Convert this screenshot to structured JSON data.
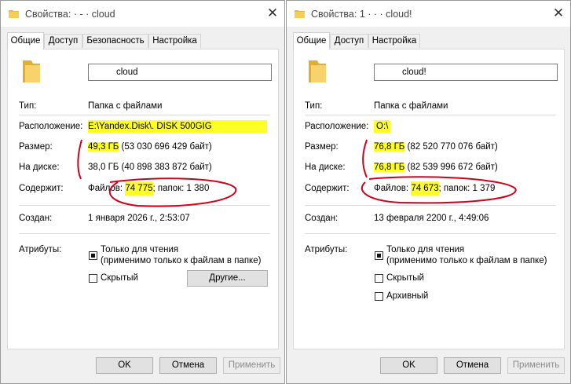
{
  "left": {
    "title": "Свойства: · - · cloud",
    "tabs": [
      "Общие",
      "Доступ",
      "Безопасность",
      "Настройка"
    ],
    "name_value": "cloud",
    "labels": {
      "type": "Тип:",
      "location": "Расположение:",
      "size": "Размер:",
      "on_disk": "На диске:",
      "contains": "Содержит:",
      "created": "Создан:",
      "attributes": "Атрибуты:"
    },
    "type_value": "Папка с файлами",
    "location_value": "E:\\Yandex.Disk\\.          DISK 500GIG",
    "size_main": "49,3 ГБ",
    "size_detail": " (53 030 696 429 байт)",
    "on_disk_value": "38,0 ГБ (40 898 383 872 байт)",
    "contains_pre": "Файлов: ",
    "contains_files": "74 775",
    "contains_post": "; папок: 1 380",
    "created_value": "1 января 2026 г., 2:53:07",
    "readonly_line1": "Только для чтения",
    "readonly_line2": "(применимо только к файлам в папке)",
    "hidden_label": "Скрытый",
    "other_button": "Другие...",
    "buttons": {
      "ok": "OK",
      "cancel": "Отмена",
      "apply": "Применить"
    }
  },
  "right": {
    "title": "Свойства: 1 · · · cloud!",
    "tabs": [
      "Общие",
      "Доступ",
      "Настройка"
    ],
    "name_value": "cloud!",
    "labels": {
      "type": "Тип:",
      "location": "Расположение:",
      "size": "Размер:",
      "on_disk": "На диске:",
      "contains": "Содержит:",
      "created": "Создан:",
      "attributes": "Атрибуты:"
    },
    "type_value": "Папка с файлами",
    "location_value": "O:\\",
    "size_main": "76,8 ГБ",
    "size_detail": " (82 520 770 076 байт)",
    "on_disk_main": "76,8 ГБ",
    "on_disk_detail": " (82 539 996 672 байт)",
    "contains_pre": "Файлов: ",
    "contains_files": "74 673",
    "contains_post": "; папок: 1 379",
    "created_value": "13 февраля 2200 г., 4:49:06",
    "readonly_line1": "Только для чтения",
    "readonly_line2": "(применимо только к файлам в папке)",
    "hidden_label": "Скрытый",
    "archive_label": "Архивный",
    "buttons": {
      "ok": "OK",
      "cancel": "Отмена",
      "apply": "Применить"
    }
  },
  "colors": {
    "highlight": "#ffff27",
    "annotation": "#d0021b"
  }
}
